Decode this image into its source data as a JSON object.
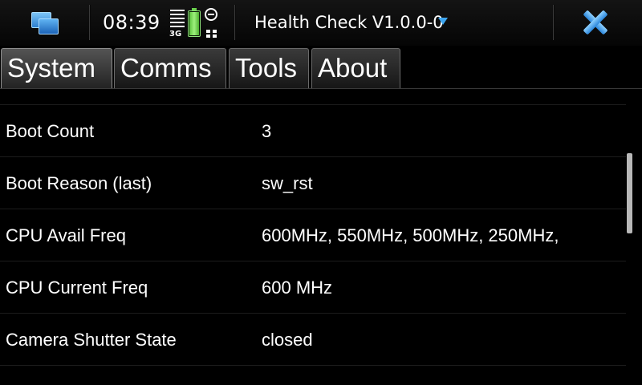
{
  "statusbar": {
    "time": "08:39",
    "network_type": "3G",
    "battery_level": 1.0,
    "icons": [
      "task-switcher-icon",
      "signal-strength-icon",
      "battery-icon",
      "presence-icon",
      "connectivity-icon",
      "close-icon"
    ],
    "accent_color": "#3ea6f0"
  },
  "app": {
    "title": "Health Check V1.0.0-0"
  },
  "tabs": [
    {
      "label": "System",
      "active": true
    },
    {
      "label": "Comms",
      "active": false
    },
    {
      "label": "Tools",
      "active": false
    },
    {
      "label": "About",
      "active": false
    }
  ],
  "rows": [
    {
      "label": "Boot Count",
      "value": "3"
    },
    {
      "label": "Boot Reason (last)",
      "value": "sw_rst"
    },
    {
      "label": "CPU Avail Freq",
      "value": "600MHz, 550MHz, 500MHz, 250MHz,"
    },
    {
      "label": "CPU Current Freq",
      "value": "600 MHz"
    },
    {
      "label": "Camera Shutter State",
      "value": "closed"
    }
  ]
}
